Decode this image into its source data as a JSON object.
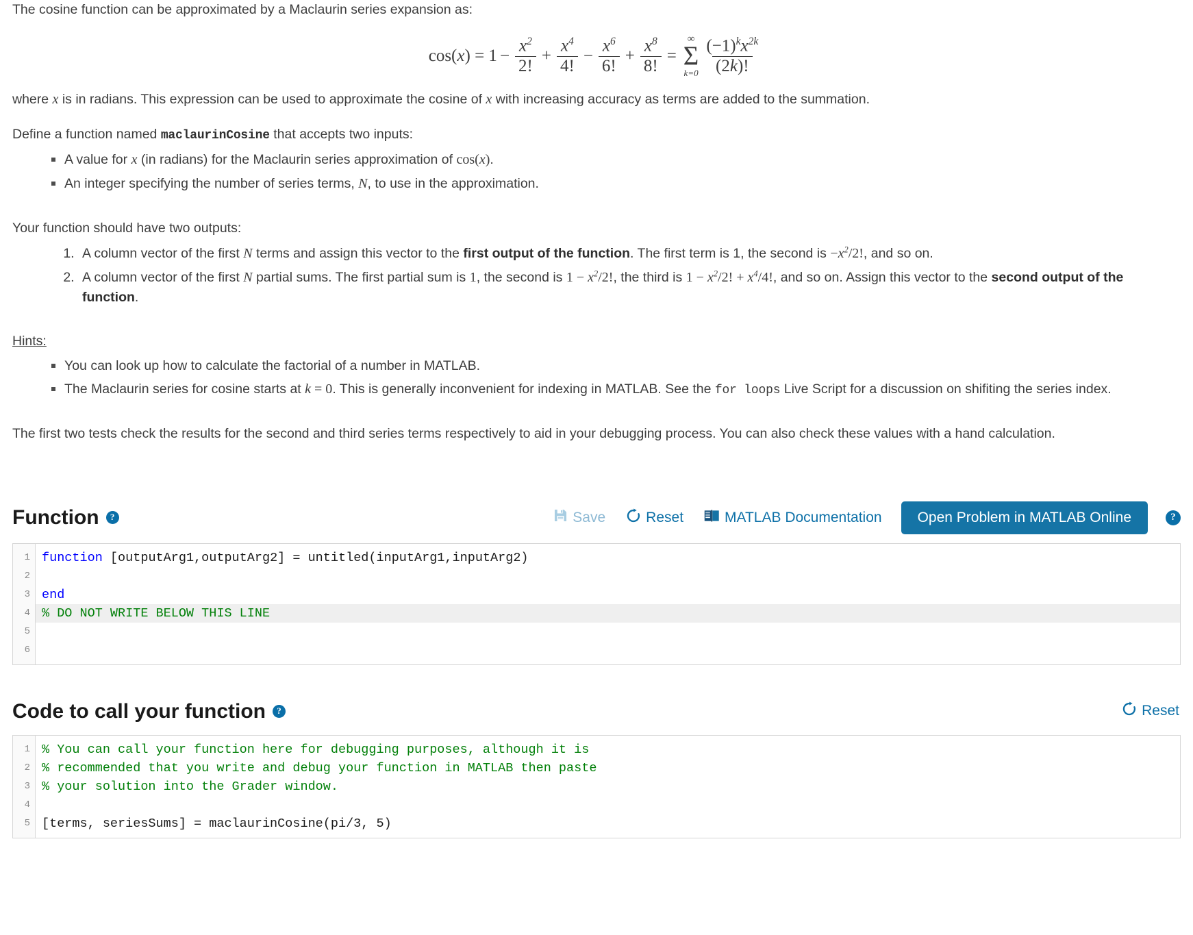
{
  "statement": {
    "intro": "The cosine function can be approximated by a Maclaurin series expansion as:",
    "formula_plain": "cos(x) = 1 - x^2/2! + x^4/4! - x^6/6! + x^8/8! = sum_{k=0}^{inf} (-1)^k x^{2k} / (2k)!",
    "formula_parts": {
      "lhs": "cos(",
      "lhs_var": "x",
      "lhs_close": ") = 1",
      "terms": [
        {
          "op": "−",
          "num_base": "x",
          "num_exp": "2",
          "den": "2!"
        },
        {
          "op": "+",
          "num_base": "x",
          "num_exp": "4",
          "den": "4!"
        },
        {
          "op": "−",
          "num_base": "x",
          "num_exp": "6",
          "den": "6!"
        },
        {
          "op": "+",
          "num_base": "x",
          "num_exp": "8",
          "den": "8!"
        }
      ],
      "equals": "=",
      "sigma_top": "∞",
      "sigma_glyph": "∑",
      "sigma_bottom": "k=0",
      "sum_num_a": "(−1)",
      "sum_num_a_exp": "k",
      "sum_num_b": "x",
      "sum_num_b_exp": "2k",
      "sum_den": "(2k)!"
    },
    "where_1": "where ",
    "where_x": "x",
    "where_2": " is in radians. This expression can be used to approximate the cosine of ",
    "where_x2": "x",
    "where_3": " with increasing accuracy as terms are added to the summation.",
    "define_1": "Define a function named ",
    "define_fn": "maclaurinCosine",
    "define_2": " that accepts two inputs:",
    "inputs": [
      {
        "a": "A value for ",
        "x": "x",
        "b": " (in radians) for the Maclaurin series approximation of ",
        "cos": "cos(x)",
        "c": "."
      },
      {
        "a": "An integer specifying the number of series terms, ",
        "x": "N",
        "b": ", to use in the approximation.",
        "cos": "",
        "c": ""
      }
    ],
    "outputs_lead": "Your function should have two outputs:",
    "output_1": {
      "p1": "A column vector of the first ",
      "n": "N",
      "p2": " terms and assign this vector to the ",
      "bold": "first output of the function",
      "p3": ". The first term is 1, the second is ",
      "math": "−x²/2!",
      "p4": ", and so on."
    },
    "output_2": {
      "p1": "A column vector of the first ",
      "n": "N",
      "p2": " partial sums. The first partial sum is ",
      "m1": "1",
      "p3": ", the second is ",
      "m2": "1 − x²/2!",
      "p4": ", the third is ",
      "m3": "1 − x²/2! + x⁴/4!",
      "p5": ", and so on.  Assign this vector to the ",
      "bold": "second output of the function",
      "p6": "."
    },
    "hints_title": "Hints:",
    "hints": [
      {
        "a": "You can look up how to calculate the factorial of a number in MATLAB.",
        "mathk": "",
        "b": "",
        "code": "",
        "c": ""
      },
      {
        "a": "The Maclaurin series for cosine starts at ",
        "mathk": "k = 0",
        "b": ". This is generally inconvenient for indexing in MATLAB. See the ",
        "code": "for  loops",
        "c": " Live Script for a discussion on shifiting the series index."
      }
    ],
    "closing": "The first two tests check the results for the second and third series terms respectively to aid in your debugging process.  You can also check these values with a hand calculation."
  },
  "function_section": {
    "title": "Function",
    "help_tooltip": "?",
    "toolbar": {
      "save": "Save",
      "save_icon": "floppy-disk-icon",
      "reset": "Reset",
      "reset_icon": "refresh-icon",
      "documentation": "MATLAB Documentation",
      "documentation_icon": "book-icon",
      "open_online": "Open Problem in MATLAB Online",
      "trailing_help": "?"
    },
    "editor": {
      "lines": [
        {
          "n": "1",
          "tokens": [
            {
              "t": "function",
              "c": "kw"
            },
            {
              "t": " [outputArg1,outputArg2] = untitled(inputArg1,inputArg2)",
              "c": "pl"
            }
          ],
          "highlight": false
        },
        {
          "n": "2",
          "tokens": [
            {
              "t": "",
              "c": "pl"
            }
          ],
          "highlight": false
        },
        {
          "n": "3",
          "tokens": [
            {
              "t": "end",
              "c": "kw"
            }
          ],
          "highlight": false
        },
        {
          "n": "4",
          "tokens": [
            {
              "t": "% DO NOT WRITE BELOW THIS LINE",
              "c": "cm"
            }
          ],
          "highlight": true
        },
        {
          "n": "5",
          "tokens": [
            {
              "t": "",
              "c": "pl"
            }
          ],
          "highlight": false
        },
        {
          "n": "6",
          "tokens": [
            {
              "t": "",
              "c": "pl"
            }
          ],
          "highlight": false
        }
      ]
    }
  },
  "call_section": {
    "title": "Code to call your function",
    "help_tooltip": "?",
    "reset": "Reset",
    "reset_icon": "refresh-icon",
    "editor": {
      "lines": [
        {
          "n": "1",
          "tokens": [
            {
              "t": "% You can call your function here for debugging purposes, although it is",
              "c": "cm"
            }
          ],
          "highlight": false
        },
        {
          "n": "2",
          "tokens": [
            {
              "t": "% recommended that you write and debug your function in MATLAB then paste",
              "c": "cm"
            }
          ],
          "highlight": false
        },
        {
          "n": "3",
          "tokens": [
            {
              "t": "% your solution into the Grader window.",
              "c": "cm"
            }
          ],
          "highlight": false
        },
        {
          "n": "4",
          "tokens": [
            {
              "t": "",
              "c": "pl"
            }
          ],
          "highlight": false
        },
        {
          "n": "5",
          "tokens": [
            {
              "t": "[terms, seriesSums] = maclaurinCosine(pi/3, 5)",
              "c": "pl"
            }
          ],
          "highlight": false
        }
      ]
    }
  },
  "colors": {
    "accent": "#1574a6",
    "link": "#0e71a8",
    "muted_link": "#8db9d4",
    "comment_green": "#028009",
    "keyword_blue": "#0000ff",
    "text": "#3d3d3d"
  }
}
